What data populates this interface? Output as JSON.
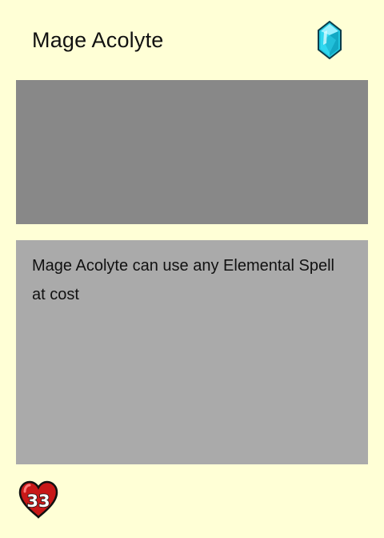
{
  "card": {
    "name": "Mage Acolyte",
    "description": "Mage Acolyte can use any Elemental Spell at cost",
    "health": "33",
    "cost_icon": "cyan-crystal-icon",
    "health_icon": "heart-icon"
  },
  "colors": {
    "background": "#ffffd6",
    "art_placeholder": "#888888",
    "text_panel": "#aaaaaa",
    "crystal": "#22c8e0",
    "heart": "#c81818"
  }
}
